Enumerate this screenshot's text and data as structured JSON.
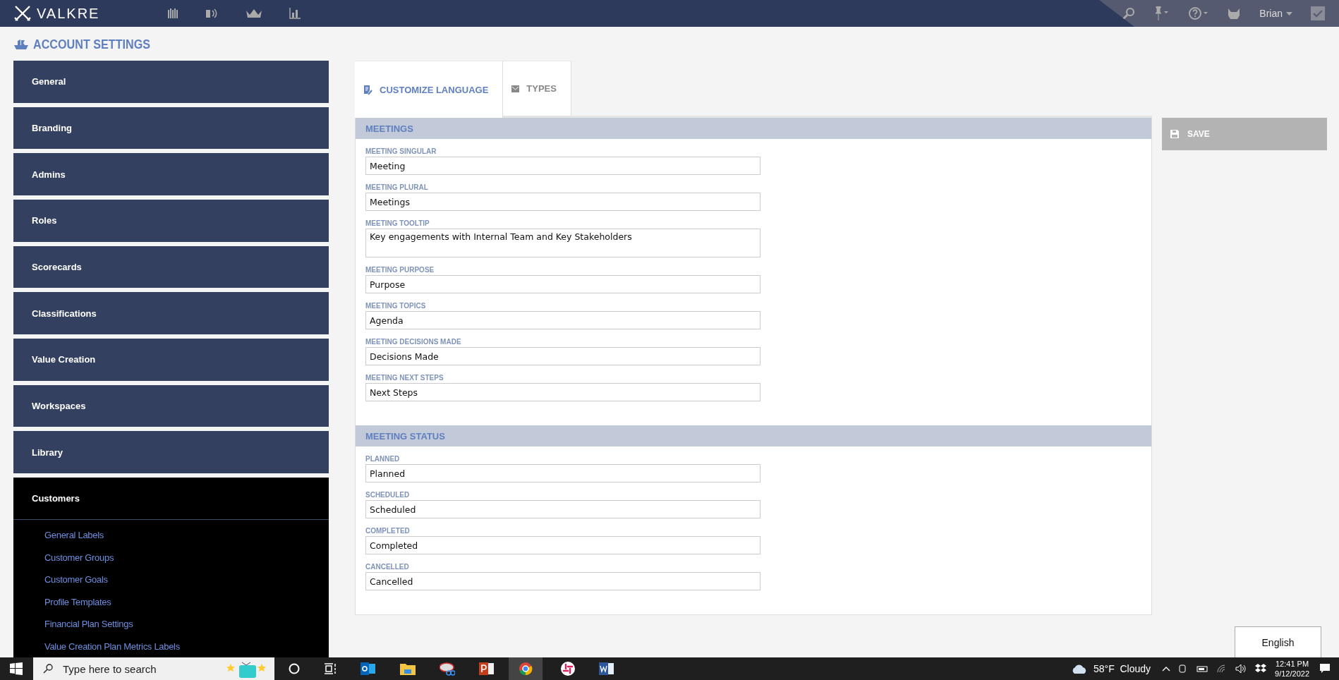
{
  "topbar": {
    "logo": "VALKRE",
    "user": "Brian"
  },
  "page_title": "ACCOUNT SETTINGS",
  "sidebar": {
    "items": [
      {
        "label": "General",
        "expanded": false
      },
      {
        "label": "Branding",
        "expanded": false
      },
      {
        "label": "Admins",
        "expanded": false
      },
      {
        "label": "Roles",
        "expanded": false
      },
      {
        "label": "Scorecards",
        "expanded": false
      },
      {
        "label": "Classifications",
        "expanded": false
      },
      {
        "label": "Value Creation",
        "expanded": false
      },
      {
        "label": "Workspaces",
        "expanded": false
      },
      {
        "label": "Library",
        "expanded": false
      },
      {
        "label": "Customers",
        "expanded": true,
        "children": [
          {
            "label": "General Labels"
          },
          {
            "label": "Customer Groups"
          },
          {
            "label": "Customer Goals"
          },
          {
            "label": "Profile Templates"
          },
          {
            "label": "Financial Plan Settings"
          },
          {
            "label": "Value Creation Plan Metrics Labels"
          }
        ]
      }
    ]
  },
  "tabs": [
    {
      "label": "CUSTOMIZE LANGUAGE",
      "selected": true
    },
    {
      "label": "TYPES",
      "selected": false
    }
  ],
  "sections": [
    {
      "title": "MEETINGS",
      "fields": [
        {
          "label": "MEETING SINGULAR",
          "value": "Meeting",
          "kind": "input"
        },
        {
          "label": "MEETING PLURAL",
          "value": "Meetings",
          "kind": "input"
        },
        {
          "label": "MEETING TOOLTIP",
          "value": "Key engagements with Internal Team and Key Stakeholders",
          "kind": "textarea"
        },
        {
          "label": "MEETING PURPOSE",
          "value": "Purpose",
          "kind": "input"
        },
        {
          "label": "MEETING TOPICS",
          "value": "Agenda",
          "kind": "input"
        },
        {
          "label": "MEETING DECISIONS MADE",
          "value": "Decisions Made",
          "kind": "input"
        },
        {
          "label": "MEETING NEXT STEPS",
          "value": "Next Steps",
          "kind": "input"
        }
      ]
    },
    {
      "title": "MEETING STATUS",
      "fields": [
        {
          "label": "PLANNED",
          "value": "Planned",
          "kind": "input"
        },
        {
          "label": "SCHEDULED",
          "value": "Scheduled",
          "kind": "input"
        },
        {
          "label": "COMPLETED",
          "value": "Completed",
          "kind": "input"
        },
        {
          "label": "CANCELLED",
          "value": "Cancelled",
          "kind": "input"
        }
      ]
    }
  ],
  "save_button": "SAVE",
  "language_button": "English",
  "taskbar": {
    "search_placeholder": "Type here to search",
    "weather": "58°F  Cloudy",
    "time": "12:41 PM",
    "date": "9/12/2022"
  }
}
